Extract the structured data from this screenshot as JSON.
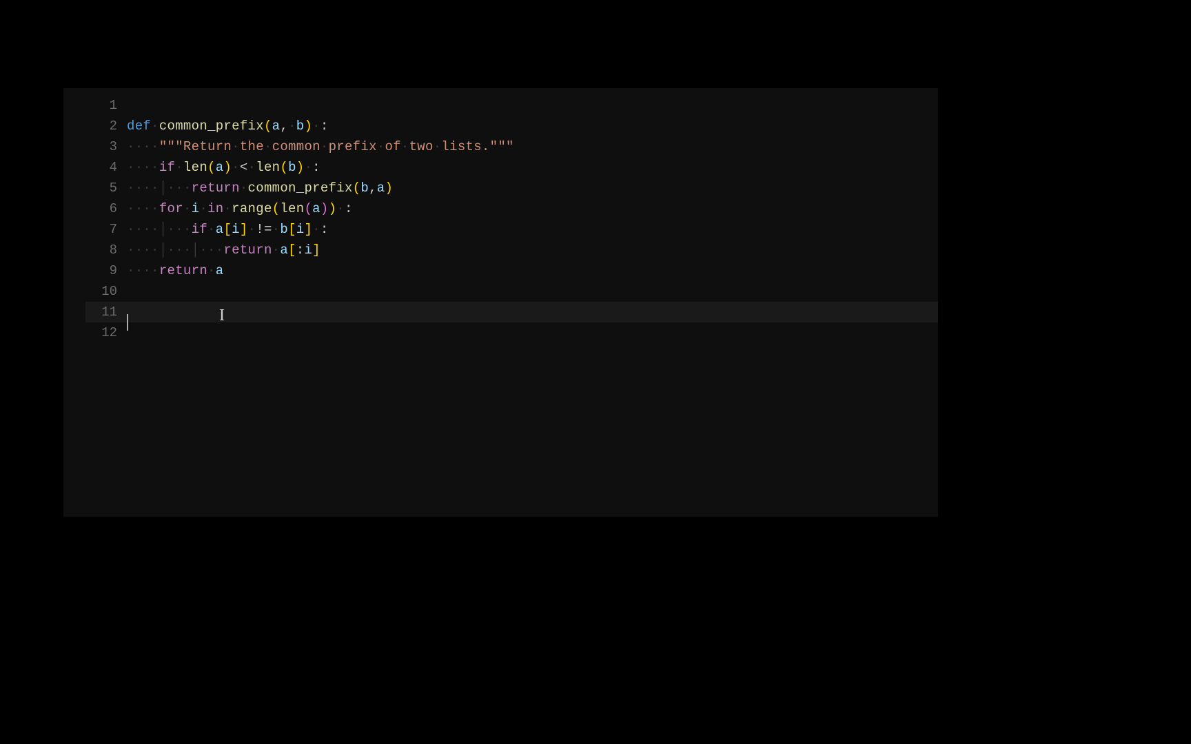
{
  "editor": {
    "lines": [
      {
        "num": "1",
        "tokens": []
      },
      {
        "num": "2",
        "tokens": [
          {
            "t": "def",
            "c": "def-kw"
          },
          {
            "t": "·",
            "c": "ws-dot"
          },
          {
            "t": "common_prefix",
            "c": "fn"
          },
          {
            "t": "(",
            "c": "bracket-y"
          },
          {
            "t": "a",
            "c": "var"
          },
          {
            "t": ",",
            "c": "op"
          },
          {
            "t": "·",
            "c": "ws-dot"
          },
          {
            "t": "b",
            "c": "var"
          },
          {
            "t": ")",
            "c": "bracket-y"
          },
          {
            "t": "·",
            "c": "ws-dot"
          },
          {
            "t": ":",
            "c": "op"
          }
        ]
      },
      {
        "num": "3",
        "tokens": [
          {
            "t": "·",
            "c": "ws-dot"
          },
          {
            "t": "·",
            "c": "ws-dot"
          },
          {
            "t": "·",
            "c": "ws-dot"
          },
          {
            "t": "·",
            "c": "ws-dot"
          },
          {
            "t": "\"\"\"Return",
            "c": "str"
          },
          {
            "t": "·",
            "c": "ws-dot"
          },
          {
            "t": "the",
            "c": "str"
          },
          {
            "t": "·",
            "c": "ws-dot"
          },
          {
            "t": "common",
            "c": "str"
          },
          {
            "t": "·",
            "c": "ws-dot"
          },
          {
            "t": "prefix",
            "c": "str"
          },
          {
            "t": "·",
            "c": "ws-dot"
          },
          {
            "t": "of",
            "c": "str"
          },
          {
            "t": "·",
            "c": "ws-dot"
          },
          {
            "t": "two",
            "c": "str"
          },
          {
            "t": "·",
            "c": "ws-dot"
          },
          {
            "t": "lists.\"\"\"",
            "c": "str"
          }
        ]
      },
      {
        "num": "4",
        "tokens": [
          {
            "t": "·",
            "c": "ws-dot"
          },
          {
            "t": "·",
            "c": "ws-dot"
          },
          {
            "t": "·",
            "c": "ws-dot"
          },
          {
            "t": "·",
            "c": "ws-dot"
          },
          {
            "t": "if",
            "c": "kw"
          },
          {
            "t": "·",
            "c": "ws-dot"
          },
          {
            "t": "len",
            "c": "builtin"
          },
          {
            "t": "(",
            "c": "bracket-y"
          },
          {
            "t": "a",
            "c": "var"
          },
          {
            "t": ")",
            "c": "bracket-y"
          },
          {
            "t": "·",
            "c": "ws-dot"
          },
          {
            "t": "<",
            "c": "op"
          },
          {
            "t": "·",
            "c": "ws-dot"
          },
          {
            "t": "len",
            "c": "builtin"
          },
          {
            "t": "(",
            "c": "bracket-y"
          },
          {
            "t": "b",
            "c": "var"
          },
          {
            "t": ")",
            "c": "bracket-y"
          },
          {
            "t": "·",
            "c": "ws-dot"
          },
          {
            "t": ":",
            "c": "op"
          }
        ]
      },
      {
        "num": "5",
        "tokens": [
          {
            "t": "·",
            "c": "ws-dot"
          },
          {
            "t": "·",
            "c": "ws-dot"
          },
          {
            "t": "·",
            "c": "ws-dot"
          },
          {
            "t": "·",
            "c": "ws-dot"
          },
          {
            "t": "│",
            "c": "indent-guide"
          },
          {
            "t": "·",
            "c": "ws-dot"
          },
          {
            "t": "·",
            "c": "ws-dot"
          },
          {
            "t": "·",
            "c": "ws-dot"
          },
          {
            "t": "return",
            "c": "kw"
          },
          {
            "t": "·",
            "c": "ws-dot"
          },
          {
            "t": "common_prefix",
            "c": "fn"
          },
          {
            "t": "(",
            "c": "bracket-y"
          },
          {
            "t": "b",
            "c": "var"
          },
          {
            "t": ",",
            "c": "op"
          },
          {
            "t": "a",
            "c": "var"
          },
          {
            "t": ")",
            "c": "bracket-y"
          }
        ]
      },
      {
        "num": "6",
        "tokens": [
          {
            "t": "·",
            "c": "ws-dot"
          },
          {
            "t": "·",
            "c": "ws-dot"
          },
          {
            "t": "·",
            "c": "ws-dot"
          },
          {
            "t": "·",
            "c": "ws-dot"
          },
          {
            "t": "for",
            "c": "kw"
          },
          {
            "t": "·",
            "c": "ws-dot"
          },
          {
            "t": "i",
            "c": "var"
          },
          {
            "t": "·",
            "c": "ws-dot"
          },
          {
            "t": "in",
            "c": "kw"
          },
          {
            "t": "·",
            "c": "ws-dot"
          },
          {
            "t": "range",
            "c": "builtin"
          },
          {
            "t": "(",
            "c": "bracket-y"
          },
          {
            "t": "len",
            "c": "builtin"
          },
          {
            "t": "(",
            "c": "bracket-p"
          },
          {
            "t": "a",
            "c": "var"
          },
          {
            "t": ")",
            "c": "bracket-p"
          },
          {
            "t": ")",
            "c": "bracket-y"
          },
          {
            "t": "·",
            "c": "ws-dot"
          },
          {
            "t": ":",
            "c": "op"
          }
        ]
      },
      {
        "num": "7",
        "tokens": [
          {
            "t": "·",
            "c": "ws-dot"
          },
          {
            "t": "·",
            "c": "ws-dot"
          },
          {
            "t": "·",
            "c": "ws-dot"
          },
          {
            "t": "·",
            "c": "ws-dot"
          },
          {
            "t": "│",
            "c": "indent-guide"
          },
          {
            "t": "·",
            "c": "ws-dot"
          },
          {
            "t": "·",
            "c": "ws-dot"
          },
          {
            "t": "·",
            "c": "ws-dot"
          },
          {
            "t": "if",
            "c": "kw"
          },
          {
            "t": "·",
            "c": "ws-dot"
          },
          {
            "t": "a",
            "c": "var"
          },
          {
            "t": "[",
            "c": "bracket-y"
          },
          {
            "t": "i",
            "c": "var"
          },
          {
            "t": "]",
            "c": "bracket-y"
          },
          {
            "t": "·",
            "c": "ws-dot"
          },
          {
            "t": "!=",
            "c": "op"
          },
          {
            "t": "·",
            "c": "ws-dot"
          },
          {
            "t": "b",
            "c": "var"
          },
          {
            "t": "[",
            "c": "bracket-y"
          },
          {
            "t": "i",
            "c": "var"
          },
          {
            "t": "]",
            "c": "bracket-y"
          },
          {
            "t": "·",
            "c": "ws-dot"
          },
          {
            "t": ":",
            "c": "op"
          }
        ]
      },
      {
        "num": "8",
        "tokens": [
          {
            "t": "·",
            "c": "ws-dot"
          },
          {
            "t": "·",
            "c": "ws-dot"
          },
          {
            "t": "·",
            "c": "ws-dot"
          },
          {
            "t": "·",
            "c": "ws-dot"
          },
          {
            "t": "│",
            "c": "indent-guide"
          },
          {
            "t": "·",
            "c": "ws-dot"
          },
          {
            "t": "·",
            "c": "ws-dot"
          },
          {
            "t": "·",
            "c": "ws-dot"
          },
          {
            "t": "│",
            "c": "indent-guide"
          },
          {
            "t": "·",
            "c": "ws-dot"
          },
          {
            "t": "·",
            "c": "ws-dot"
          },
          {
            "t": "·",
            "c": "ws-dot"
          },
          {
            "t": "return",
            "c": "kw"
          },
          {
            "t": "·",
            "c": "ws-dot"
          },
          {
            "t": "a",
            "c": "var"
          },
          {
            "t": "[",
            "c": "bracket-y"
          },
          {
            "t": ":",
            "c": "op"
          },
          {
            "t": "i",
            "c": "var"
          },
          {
            "t": "]",
            "c": "bracket-y"
          }
        ]
      },
      {
        "num": "9",
        "tokens": [
          {
            "t": "·",
            "c": "ws-dot"
          },
          {
            "t": "·",
            "c": "ws-dot"
          },
          {
            "t": "·",
            "c": "ws-dot"
          },
          {
            "t": "·",
            "c": "ws-dot"
          },
          {
            "t": "return",
            "c": "kw"
          },
          {
            "t": "·",
            "c": "ws-dot"
          },
          {
            "t": "a",
            "c": "var"
          }
        ]
      },
      {
        "num": "10",
        "tokens": []
      },
      {
        "num": "11",
        "tokens": [],
        "current": true
      },
      {
        "num": "12",
        "tokens": []
      }
    ],
    "cursor_line": 11
  }
}
